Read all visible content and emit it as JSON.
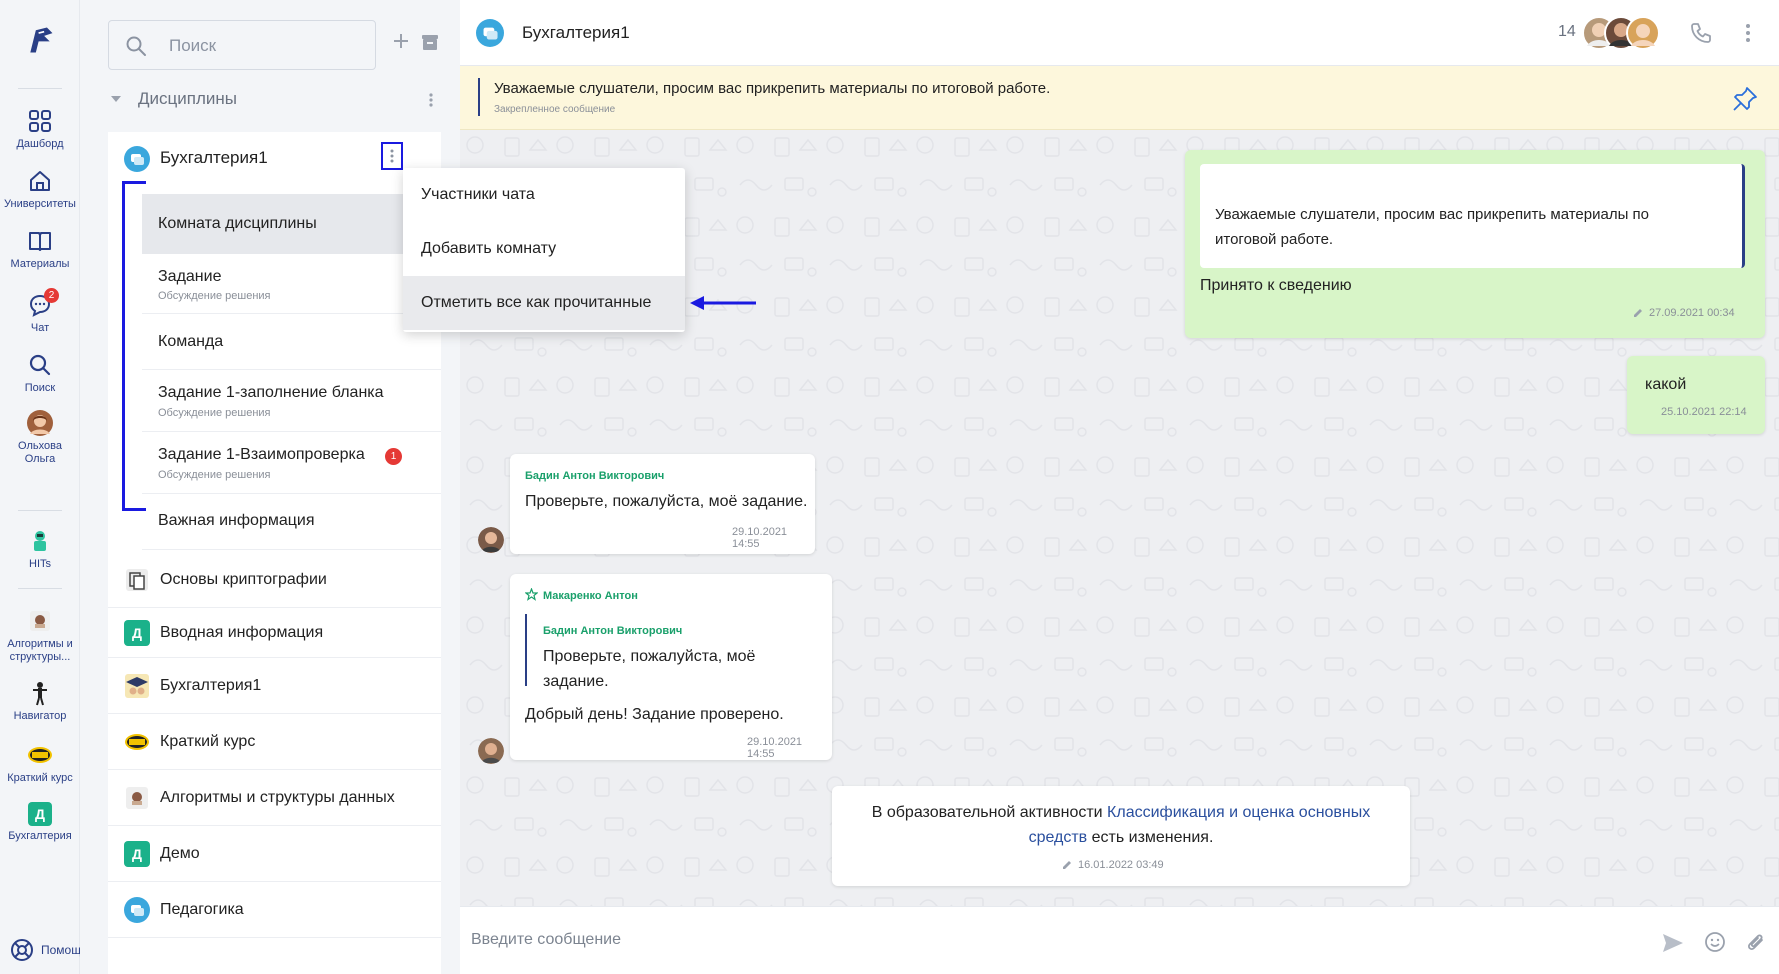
{
  "rail": {
    "items": [
      {
        "label": "Дашборд",
        "icon": "dashboard-icon"
      },
      {
        "label": "Университеты",
        "icon": "home-icon"
      },
      {
        "label": "Материалы",
        "icon": "book-icon"
      },
      {
        "label": "Чат",
        "icon": "chat-icon",
        "badge": "2"
      },
      {
        "label": "Поиск",
        "icon": "search-icon"
      },
      {
        "label": "Ольхова Ольга",
        "icon": "user-avatar"
      },
      {
        "label": "HITs",
        "icon": "hits-icon"
      },
      {
        "label": "Алгоритмы и структуры...",
        "icon": "course-icon"
      },
      {
        "label": "Навигатор",
        "icon": "navigator-icon"
      },
      {
        "label": "Краткий курс",
        "icon": "demo-icon"
      },
      {
        "label": "Бухгалтерия",
        "icon": "d-icon",
        "letter": "Д"
      }
    ],
    "help": "Помощь"
  },
  "panel": {
    "search_placeholder": "Поиск",
    "section": "Дисциплины",
    "group_title": "Бухгалтерия1",
    "rooms": [
      {
        "title": "Комната дисциплины",
        "sub": ""
      },
      {
        "title": "Задание",
        "sub": "Обсуждение решения"
      },
      {
        "title": "Команда",
        "sub": ""
      },
      {
        "title": "Задание 1-заполнение бланка",
        "sub": "Обсуждение решения"
      },
      {
        "title": "Задание 1-Взаимопроверка",
        "sub": "Обсуждение решения",
        "badge": "1"
      },
      {
        "title": "Важная информация",
        "sub": ""
      }
    ],
    "channels": [
      {
        "title": "Основы криптографии"
      },
      {
        "title": "Вводная информация",
        "letter": "Д"
      },
      {
        "title": "Бухгалтерия1"
      },
      {
        "title": "Краткий курс",
        "letter": "DEMO"
      },
      {
        "title": "Алгоритмы и структуры данных"
      },
      {
        "title": "Демо",
        "letter": "Д"
      },
      {
        "title": "Педагогика"
      }
    ]
  },
  "menu": {
    "items": [
      "Участники чата",
      "Добавить комнату",
      "Отметить все как прочитанные"
    ]
  },
  "chat": {
    "title": "Бухгалтерия1",
    "members_count": "14",
    "pinned_text": "Уважаемые слушатели, просим вас прикрепить материалы по итоговой работе.",
    "pinned_label": "Закрепленное сообщение",
    "composer_placeholder": "Введите сообщение",
    "messages": {
      "m1_quote_line1": "Уважаемые слушатели, просим вас прикрепить материалы по",
      "m1_quote_line2": "итоговой работе.",
      "m1_text": "Принято к сведению",
      "m1_time": "27.09.2021 00:34",
      "m2_text": "какой",
      "m2_time": "25.10.2021 22:14",
      "m3_author": "Бадин Антон Викторович",
      "m3_text": "Проверьте, пожалуйста, моё задание.",
      "m3_time": "29.10.2021 14:55",
      "m4_author": "Макаренко Антон",
      "m4_quote_author": "Бадин Антон Викторович",
      "m4_quote_text": "Проверьте, пожалуйста, моё задание.",
      "m4_text": "Добрый день! Задание проверено.",
      "m4_time": "29.10.2021 14:55",
      "sys_prefix": "В образовательной активности ",
      "sys_link1": "Классификация и оценка основных",
      "sys_link2": "средств",
      "sys_suffix": " есть изменения.",
      "sys_time": "16.01.2022 03:49"
    }
  },
  "colors": {
    "accent": "#2a3f86",
    "annotation_blue": "#1a1ae0",
    "out_bubble": "#d8f5c8",
    "pinned_bg": "#fdf7dc",
    "author_green": "#1aa06b",
    "link": "#2a4f9e"
  }
}
